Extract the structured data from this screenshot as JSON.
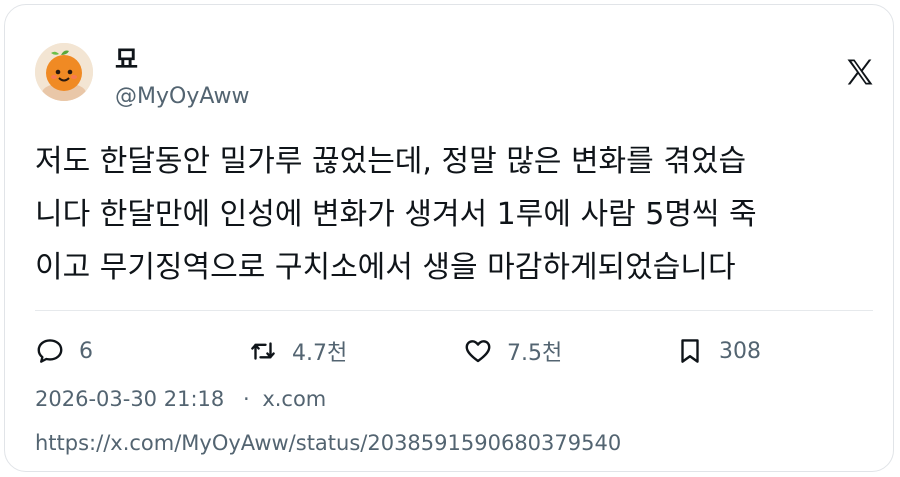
{
  "user": {
    "display_name": "묘",
    "handle": "@MyOyAww"
  },
  "tweet": {
    "text": "저도 한달동안 밀가루 끊었는데, 정말 많은 변화를 겪었습\n니다 한달만에 인성에 변화가 생겨서 1루에 사람 5명씩 죽\n이고 무기징역으로 구치소에서 생을 마감하게되었습니다"
  },
  "actions": {
    "replies": "6",
    "retweets": "4.7천",
    "likes": "7.5천",
    "bookmarks": "308"
  },
  "meta": {
    "timestamp": "2026-03-30 21:18",
    "separator": "·",
    "source": "x.com",
    "url": "https://x.com/MyOyAww/status/2038591590680379540"
  },
  "icons": {
    "avatar": "orange-mascot-avatar",
    "platform": "x-logo-icon",
    "reply": "comment-icon",
    "retweet": "retweet-icon",
    "like": "heart-icon",
    "bookmark": "bookmark-icon"
  },
  "colors": {
    "text": "#0f1419",
    "secondary": "#536471",
    "border": "#e1e4e8"
  }
}
